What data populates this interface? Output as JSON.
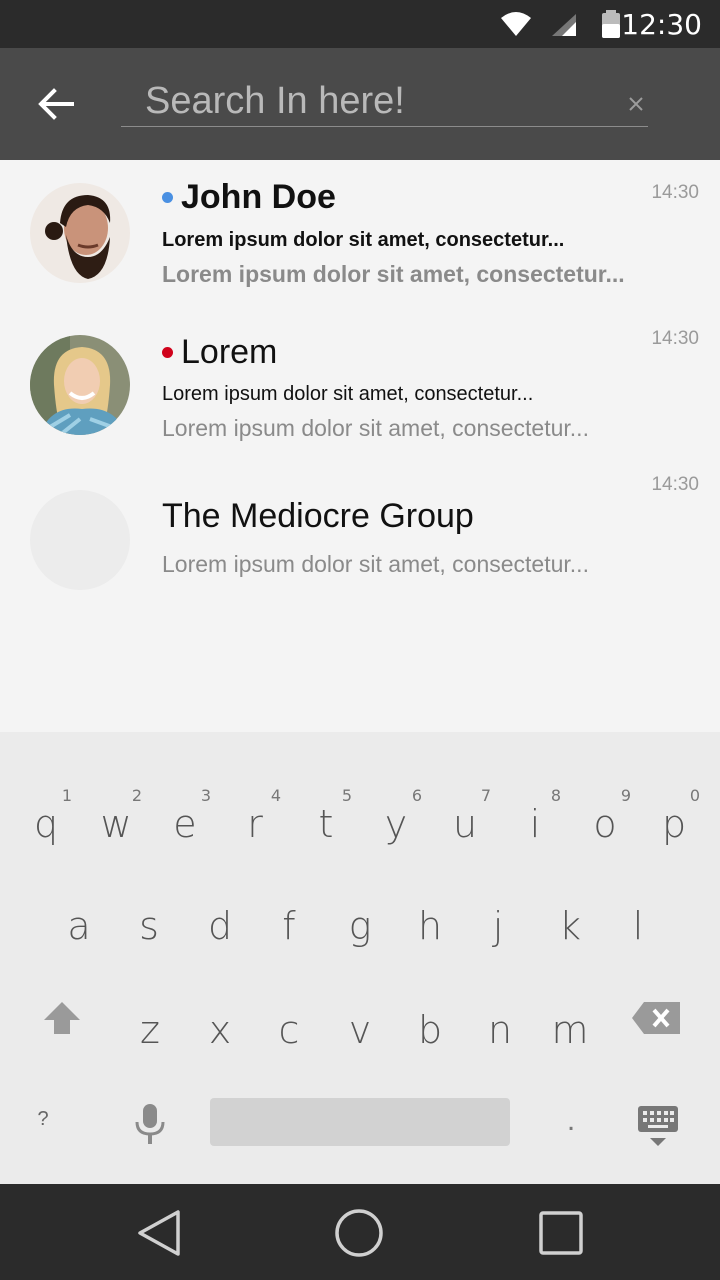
{
  "status_bar": {
    "time": "12:30"
  },
  "search": {
    "placeholder": "Search In here!",
    "value": ""
  },
  "conversations": [
    {
      "name": "John Doe",
      "time": "14:30",
      "line1": "Lorem ipsum dolor sit amet, consectetur...",
      "line2": "Lorem ipsum dolor sit amet, consectetur...",
      "status_color": "#4a90e2"
    },
    {
      "name": "Lorem",
      "time": "14:30",
      "line1": "Lorem ipsum dolor sit amet, consectetur...",
      "line2": "Lorem ipsum dolor sit amet, consectetur...",
      "status_color": "#d0021b"
    },
    {
      "name": "The Mediocre Group",
      "time": "14:30",
      "line2": "Lorem ipsum dolor sit amet, consectetur..."
    }
  ],
  "keyboard": {
    "row1": [
      {
        "hint": "1",
        "char": "q"
      },
      {
        "hint": "2",
        "char": "w"
      },
      {
        "hint": "3",
        "char": "e"
      },
      {
        "hint": "4",
        "char": "r"
      },
      {
        "hint": "5",
        "char": "t"
      },
      {
        "hint": "6",
        "char": "y"
      },
      {
        "hint": "7",
        "char": "u"
      },
      {
        "hint": "8",
        "char": "i"
      },
      {
        "hint": "9",
        "char": "o"
      },
      {
        "hint": "0",
        "char": "p"
      }
    ],
    "row2": [
      "a",
      "s",
      "d",
      "f",
      "g",
      "h",
      "j",
      "k",
      "l"
    ],
    "row3": [
      "z",
      "x",
      "c",
      "v",
      "b",
      "n",
      "m"
    ],
    "symbols_label": "?",
    "period_label": "."
  },
  "colors": {
    "status_bar": "#2b2b2b",
    "toolbar": "#4a4a4a",
    "list_bg": "#f4f4f4",
    "keyboard_bg": "#ebebeb",
    "nav_bar": "#2b2b2b"
  }
}
